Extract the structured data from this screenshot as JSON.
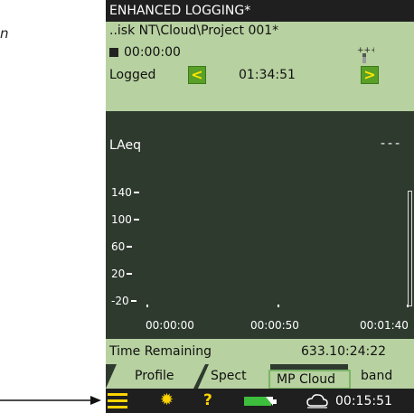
{
  "figure_label": "n",
  "title": "ENHANCED LOGGING*",
  "project_path": "..isk NT\\Cloud\\Project 001*",
  "timer": "00:00:00",
  "logged": {
    "label": "Logged",
    "time": "01:34:51",
    "prev_label": "<",
    "next_label": ">"
  },
  "graph": {
    "parameter": "LAeq",
    "value_placeholder": "---",
    "y_ticks": [
      "140",
      "100",
      "60",
      "20",
      "-20"
    ],
    "x_ticks": [
      "00:00:00",
      "00:00:50",
      "00:01:40"
    ]
  },
  "time_remaining": {
    "label": "Time Remaining",
    "value": "633.10:24:22"
  },
  "tabs": [
    "Profile",
    "Spect",
    "band"
  ],
  "popup": "MP Cloud",
  "status": {
    "clock": "00:15:51"
  },
  "icons": [
    "stop-icon",
    "gps-icon",
    "menu-icon",
    "light-icon",
    "help-icon",
    "battery-icon",
    "cloud-icon",
    "arrow-icon"
  ],
  "colors": {
    "panel": "#b7d1a0",
    "graph_bg": "#2f3a2f",
    "accent_button": "#5aa028",
    "icon_yellow": "#ffd400"
  }
}
